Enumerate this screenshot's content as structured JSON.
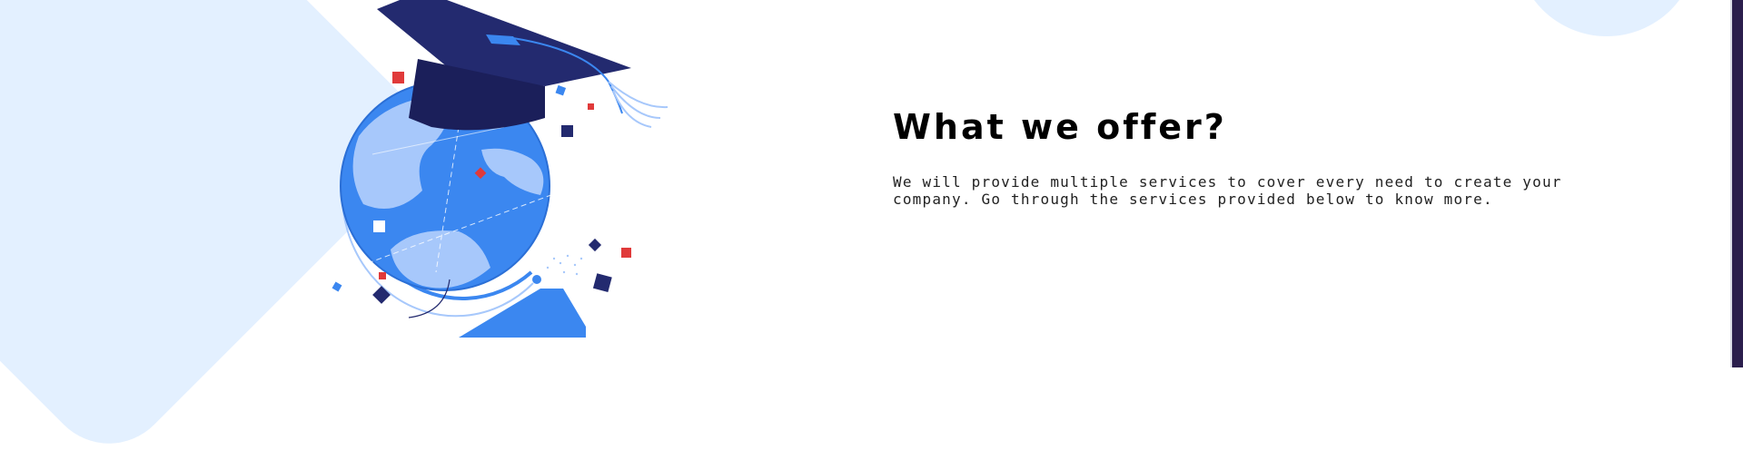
{
  "section": {
    "heading": "What we offer?",
    "description": "We will provide multiple services to cover every need to create your company. Go through the services provided below to know more."
  },
  "illustration": {
    "icon": "globe-graduation-cap-icon"
  },
  "colors": {
    "accent_blue": "#3b87f0",
    "light_blue": "#a7c8fb",
    "navy": "#1e2166",
    "red": "#e03a3a",
    "background_tint": "#e3f0ff"
  }
}
